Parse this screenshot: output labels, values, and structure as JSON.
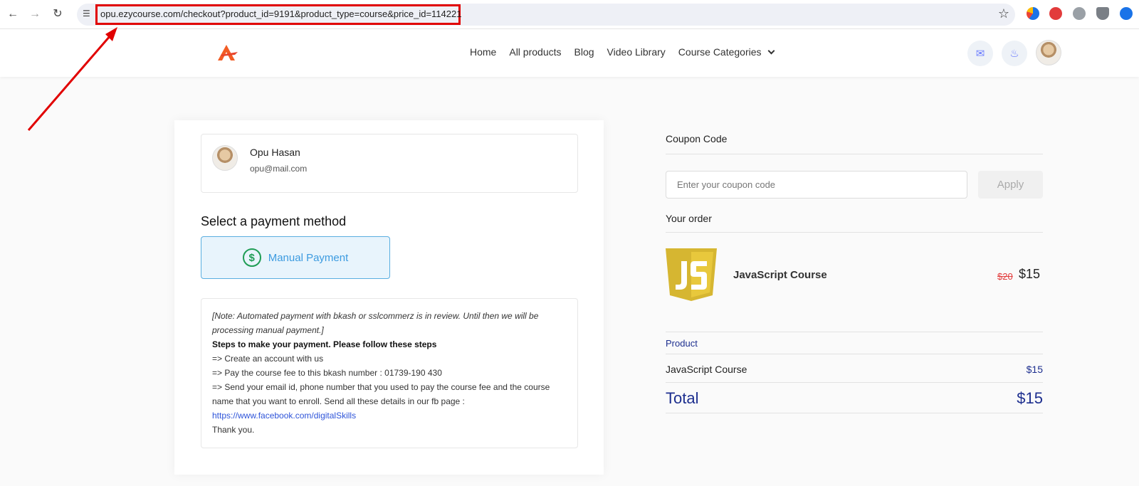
{
  "browser": {
    "url": "opu.ezycourse.com/checkout?product_id=9191&product_type=course&price_id=114221",
    "back_icon": "arrow-left",
    "forward_icon": "arrow-right",
    "reload_icon": "reload",
    "highlight_color": "#e10000"
  },
  "header": {
    "nav": [
      {
        "label": "Home"
      },
      {
        "label": "All products"
      },
      {
        "label": "Blog"
      },
      {
        "label": "Video Library"
      },
      {
        "label": "Course Categories"
      }
    ]
  },
  "profile": {
    "name": "Opu Hasan",
    "email": "opu@mail.com"
  },
  "payment": {
    "title": "Select a payment method",
    "method_label": "Manual Payment",
    "note_italic": "[Note: Automated payment with bkash or sslcommerz is in review. Until then we will be processing manual payment.]",
    "steps_heading": "Steps to make your payment. Please follow these steps",
    "step1": "=> Create an account with us",
    "step2": "=> Pay the course fee to this bkash number : 01739-190 430",
    "step3": "=> Send your email id, phone number that you used to pay the course fee and the course name that you want to enroll. Send all these details in our fb page :",
    "link": "https://www.facebook.com/digitalSkills",
    "thanks": "Thank you."
  },
  "coupon": {
    "label": "Coupon Code",
    "placeholder": "Enter your coupon code",
    "apply_label": "Apply"
  },
  "order": {
    "label": "Your order",
    "item_name": "JavaScript Course",
    "old_price": "$20",
    "new_price": "$15"
  },
  "summary": {
    "product_label": "Product",
    "item_name": "JavaScript Course",
    "item_price": "$15",
    "total_label": "Total",
    "total_price": "$15",
    "accent_color": "#1d2f8f"
  }
}
